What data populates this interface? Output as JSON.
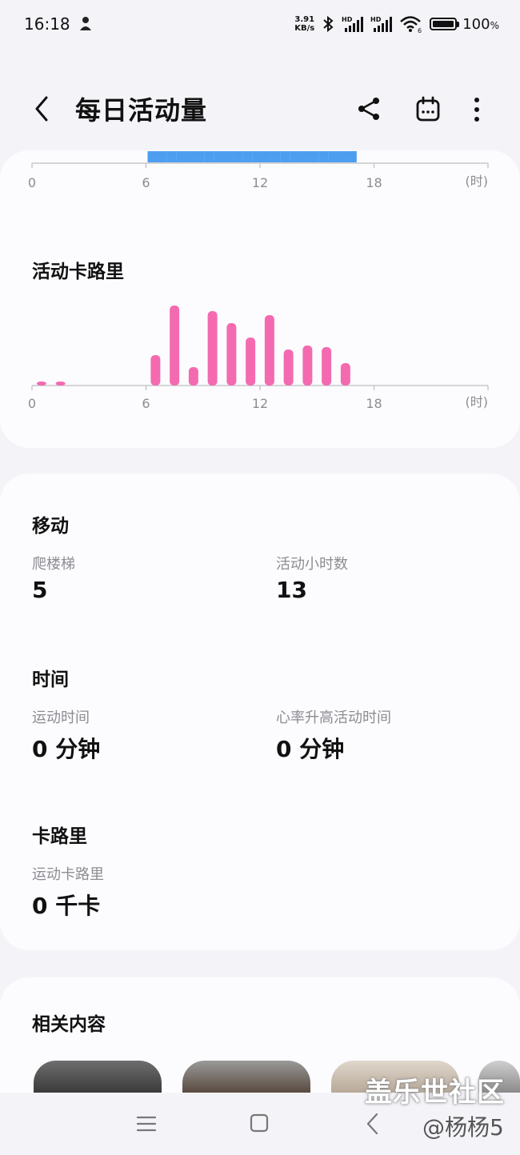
{
  "status_bar": {
    "time": "16:18",
    "net_speed_value": "3.91",
    "net_speed_unit": "KB/s",
    "battery_percent": "100",
    "battery_symbol": "%",
    "signal_labels": [
      "HD",
      "HD"
    ],
    "wifi_label": "6",
    "icons": [
      "notification-icon",
      "bluetooth-icon",
      "signal-icon",
      "wifi-icon",
      "battery-icon"
    ]
  },
  "header": {
    "title": "每日活动量",
    "icons": [
      "back-icon",
      "share-icon",
      "calendar-icon",
      "more-icon"
    ]
  },
  "colors": {
    "activity_blue": "#4e9ef0",
    "calorie_pink": "#f46ab0",
    "background": "#f4f4f8",
    "card": "#fcfcff"
  },
  "chart_data": [
    {
      "type": "bar",
      "title": "",
      "x_ticks": [
        "0",
        "6",
        "12",
        "18"
      ],
      "x_unit": "(时)",
      "x_range": [
        0,
        24
      ],
      "active_slots_hours": [
        6,
        7,
        8,
        9,
        10,
        11,
        12,
        13,
        14,
        15,
        16
      ]
    },
    {
      "type": "bar",
      "title": "活动卡路里",
      "x_ticks": [
        "0",
        "6",
        "12",
        "18"
      ],
      "x_unit": "(时)",
      "x_range": [
        0,
        24
      ],
      "hours": [
        0,
        1,
        6,
        7,
        8,
        9,
        10,
        11,
        12,
        13,
        14,
        15,
        16
      ],
      "values": [
        5,
        5,
        38,
        100,
        23,
        93,
        78,
        60,
        88,
        45,
        50,
        48,
        28
      ]
    }
  ],
  "move": {
    "title": "移动",
    "stairs_label": "爬楼梯",
    "stairs_value": "5",
    "active_hours_label": "活动小时数",
    "active_hours_value": "13"
  },
  "time_section": {
    "title": "时间",
    "exercise_label": "运动时间",
    "exercise_value": "0 分钟",
    "hr_label": "心率升高活动时间",
    "hr_value": "0 分钟"
  },
  "calories": {
    "title": "卡路里",
    "exercise_cal_label": "运动卡路里",
    "exercise_cal_value": "0 千卡"
  },
  "related": {
    "title": "相关内容"
  },
  "watermark": {
    "text": "盖乐世社区",
    "user": "@杨杨5"
  },
  "nav": {
    "icons": [
      "recents-icon",
      "home-icon",
      "back-nav-icon"
    ]
  }
}
